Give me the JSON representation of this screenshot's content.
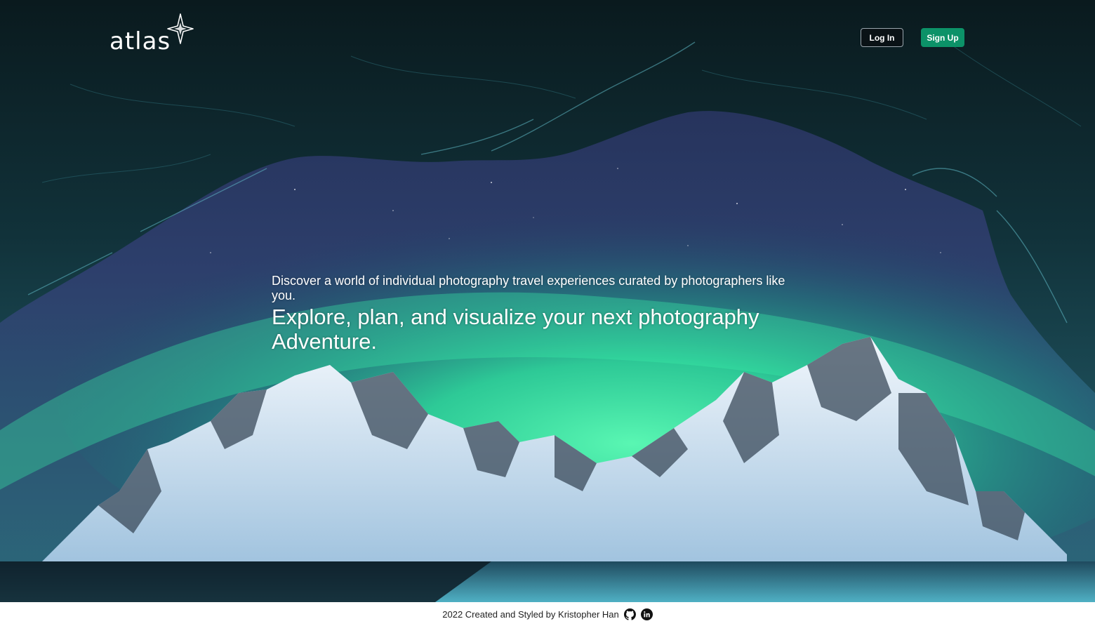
{
  "brand": {
    "name": "atlas",
    "logo_icon": "compass-star-icon"
  },
  "nav": {
    "login_label": "Log In",
    "signup_label": "Sign Up"
  },
  "hero": {
    "subheading": "Discover a world of individual photography travel experiences curated by photographers like you.",
    "headline": "Explore, plan, and visualize your next photography Adventure."
  },
  "footer": {
    "credit": "2022 Created and Styled by Kristopher Han",
    "icons": [
      "github-icon",
      "linkedin-icon"
    ]
  },
  "colors": {
    "accent": "#0c9268",
    "aurora": "#2ef0a0",
    "sky": "#2a3a66",
    "rock": "#0b1c22",
    "snow": "#dce8f4"
  }
}
